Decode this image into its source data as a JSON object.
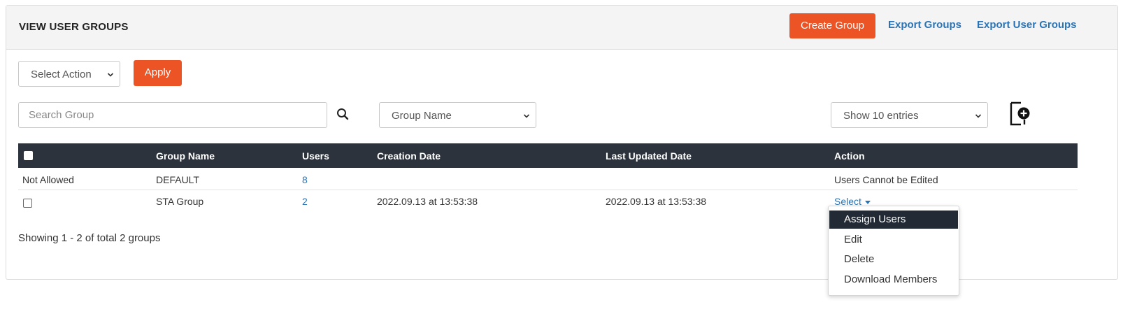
{
  "header": {
    "title": "VIEW USER GROUPS",
    "create_label": "Create Group",
    "export_groups_label": "Export Groups",
    "export_user_groups_label": "Export User Groups"
  },
  "toolbar": {
    "bulk_action_value": "Select Action",
    "apply_label": "Apply",
    "search_placeholder": "Search Group",
    "search_column_value": "Group Name",
    "page_size_value": "Show 10 entries"
  },
  "table": {
    "columns": [
      "Group Name",
      "Users",
      "Creation Date",
      "Last Updated Date",
      "Action"
    ],
    "rows": [
      {
        "selection": "Not Allowed",
        "group_name": "DEFAULT",
        "users": "8",
        "creation_date": "",
        "last_updated": "",
        "action": "Users Cannot be Edited"
      },
      {
        "selection": "",
        "group_name": "STA Group",
        "users": "2",
        "creation_date": "2022.09.13 at 13:53:38",
        "last_updated": "2022.09.13 at 13:53:38",
        "action": "Select"
      }
    ]
  },
  "summary": "Showing 1 - 2 of total 2 groups",
  "action_menu": {
    "items": [
      "Assign Users",
      "Edit",
      "Delete",
      "Download Members"
    ],
    "highlighted_index": 0
  },
  "colors": {
    "accent": "#ec5426",
    "link": "#2a74b6",
    "table_header": "#2c333c"
  },
  "icons": {
    "search": "magnifier-icon",
    "add": "document-plus-icon",
    "chevron": "chevron-down-icon"
  }
}
